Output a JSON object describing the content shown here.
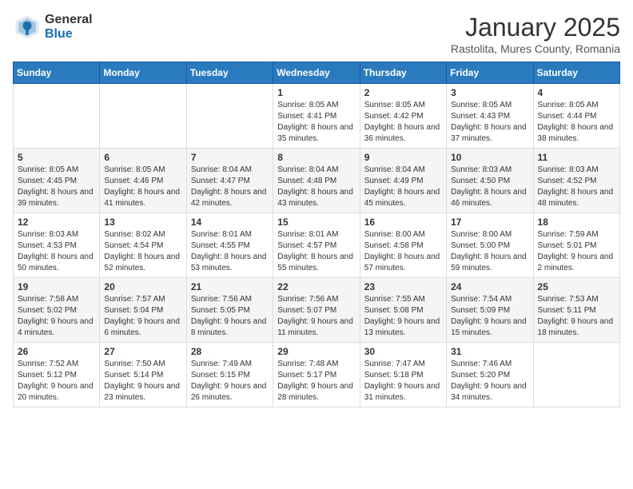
{
  "header": {
    "logo_general": "General",
    "logo_blue": "Blue",
    "month_title": "January 2025",
    "location": "Rastolita, Mures County, Romania"
  },
  "weekdays": [
    "Sunday",
    "Monday",
    "Tuesday",
    "Wednesday",
    "Thursday",
    "Friday",
    "Saturday"
  ],
  "weeks": [
    [
      {
        "day": "",
        "info": ""
      },
      {
        "day": "",
        "info": ""
      },
      {
        "day": "",
        "info": ""
      },
      {
        "day": "1",
        "info": "Sunrise: 8:05 AM\nSunset: 4:41 PM\nDaylight: 8 hours and 35 minutes."
      },
      {
        "day": "2",
        "info": "Sunrise: 8:05 AM\nSunset: 4:42 PM\nDaylight: 8 hours and 36 minutes."
      },
      {
        "day": "3",
        "info": "Sunrise: 8:05 AM\nSunset: 4:43 PM\nDaylight: 8 hours and 37 minutes."
      },
      {
        "day": "4",
        "info": "Sunrise: 8:05 AM\nSunset: 4:44 PM\nDaylight: 8 hours and 38 minutes."
      }
    ],
    [
      {
        "day": "5",
        "info": "Sunrise: 8:05 AM\nSunset: 4:45 PM\nDaylight: 8 hours and 39 minutes."
      },
      {
        "day": "6",
        "info": "Sunrise: 8:05 AM\nSunset: 4:46 PM\nDaylight: 8 hours and 41 minutes."
      },
      {
        "day": "7",
        "info": "Sunrise: 8:04 AM\nSunset: 4:47 PM\nDaylight: 8 hours and 42 minutes."
      },
      {
        "day": "8",
        "info": "Sunrise: 8:04 AM\nSunset: 4:48 PM\nDaylight: 8 hours and 43 minutes."
      },
      {
        "day": "9",
        "info": "Sunrise: 8:04 AM\nSunset: 4:49 PM\nDaylight: 8 hours and 45 minutes."
      },
      {
        "day": "10",
        "info": "Sunrise: 8:03 AM\nSunset: 4:50 PM\nDaylight: 8 hours and 46 minutes."
      },
      {
        "day": "11",
        "info": "Sunrise: 8:03 AM\nSunset: 4:52 PM\nDaylight: 8 hours and 48 minutes."
      }
    ],
    [
      {
        "day": "12",
        "info": "Sunrise: 8:03 AM\nSunset: 4:53 PM\nDaylight: 8 hours and 50 minutes."
      },
      {
        "day": "13",
        "info": "Sunrise: 8:02 AM\nSunset: 4:54 PM\nDaylight: 8 hours and 52 minutes."
      },
      {
        "day": "14",
        "info": "Sunrise: 8:01 AM\nSunset: 4:55 PM\nDaylight: 8 hours and 53 minutes."
      },
      {
        "day": "15",
        "info": "Sunrise: 8:01 AM\nSunset: 4:57 PM\nDaylight: 8 hours and 55 minutes."
      },
      {
        "day": "16",
        "info": "Sunrise: 8:00 AM\nSunset: 4:58 PM\nDaylight: 8 hours and 57 minutes."
      },
      {
        "day": "17",
        "info": "Sunrise: 8:00 AM\nSunset: 5:00 PM\nDaylight: 8 hours and 59 minutes."
      },
      {
        "day": "18",
        "info": "Sunrise: 7:59 AM\nSunset: 5:01 PM\nDaylight: 9 hours and 2 minutes."
      }
    ],
    [
      {
        "day": "19",
        "info": "Sunrise: 7:58 AM\nSunset: 5:02 PM\nDaylight: 9 hours and 4 minutes."
      },
      {
        "day": "20",
        "info": "Sunrise: 7:57 AM\nSunset: 5:04 PM\nDaylight: 9 hours and 6 minutes."
      },
      {
        "day": "21",
        "info": "Sunrise: 7:56 AM\nSunset: 5:05 PM\nDaylight: 9 hours and 8 minutes."
      },
      {
        "day": "22",
        "info": "Sunrise: 7:56 AM\nSunset: 5:07 PM\nDaylight: 9 hours and 11 minutes."
      },
      {
        "day": "23",
        "info": "Sunrise: 7:55 AM\nSunset: 5:08 PM\nDaylight: 9 hours and 13 minutes."
      },
      {
        "day": "24",
        "info": "Sunrise: 7:54 AM\nSunset: 5:09 PM\nDaylight: 9 hours and 15 minutes."
      },
      {
        "day": "25",
        "info": "Sunrise: 7:53 AM\nSunset: 5:11 PM\nDaylight: 9 hours and 18 minutes."
      }
    ],
    [
      {
        "day": "26",
        "info": "Sunrise: 7:52 AM\nSunset: 5:12 PM\nDaylight: 9 hours and 20 minutes."
      },
      {
        "day": "27",
        "info": "Sunrise: 7:50 AM\nSunset: 5:14 PM\nDaylight: 9 hours and 23 minutes."
      },
      {
        "day": "28",
        "info": "Sunrise: 7:49 AM\nSunset: 5:15 PM\nDaylight: 9 hours and 26 minutes."
      },
      {
        "day": "29",
        "info": "Sunrise: 7:48 AM\nSunset: 5:17 PM\nDaylight: 9 hours and 28 minutes."
      },
      {
        "day": "30",
        "info": "Sunrise: 7:47 AM\nSunset: 5:18 PM\nDaylight: 9 hours and 31 minutes."
      },
      {
        "day": "31",
        "info": "Sunrise: 7:46 AM\nSunset: 5:20 PM\nDaylight: 9 hours and 34 minutes."
      },
      {
        "day": "",
        "info": ""
      }
    ]
  ]
}
